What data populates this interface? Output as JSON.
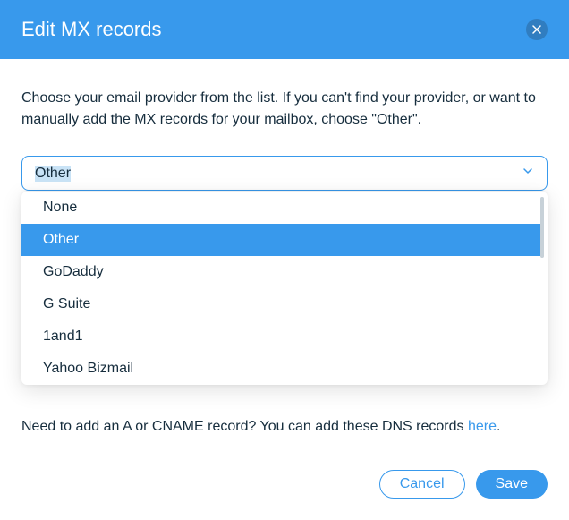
{
  "header": {
    "title": "Edit MX records"
  },
  "body": {
    "description": "Choose your email provider from the list. If you can't find your provider, or want to manually add the MX records for your mailbox, choose \"Other\".",
    "select": {
      "selected": "Other",
      "options": [
        {
          "label": "None",
          "selected": false
        },
        {
          "label": "Other",
          "selected": true
        },
        {
          "label": "GoDaddy",
          "selected": false
        },
        {
          "label": "G Suite",
          "selected": false
        },
        {
          "label": "1and1",
          "selected": false
        },
        {
          "label": "Yahoo Bizmail",
          "selected": false
        }
      ]
    },
    "note_prefix": "Need to add an A or CNAME record? You can add these DNS records ",
    "note_link": "here",
    "note_suffix": "."
  },
  "footer": {
    "cancel": "Cancel",
    "save": "Save"
  }
}
